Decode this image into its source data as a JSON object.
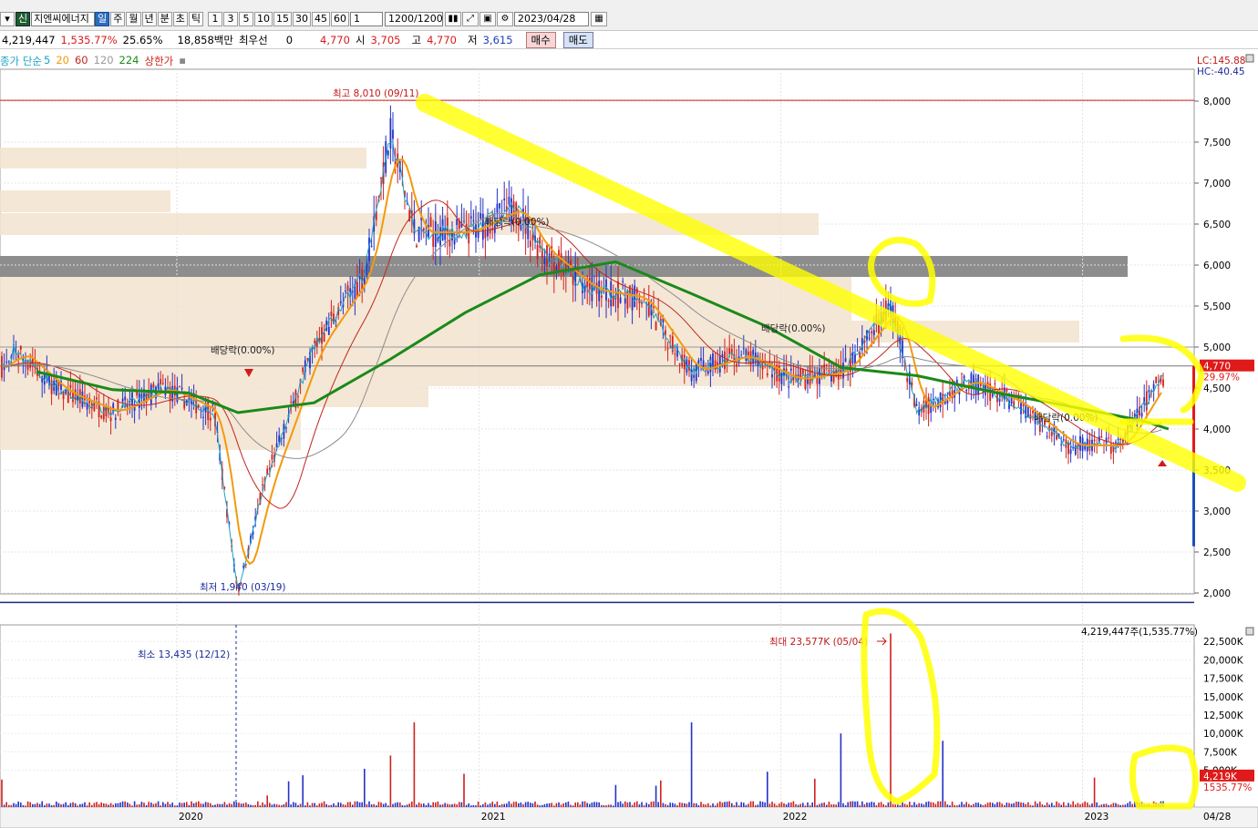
{
  "toolbar": {
    "code_badge": "신",
    "stock_name": "지엔씨에너지",
    "periods": [
      "일",
      "주",
      "월",
      "년",
      "분",
      "초",
      "틱"
    ],
    "active_period": "일",
    "minutes": [
      "1",
      "3",
      "5",
      "10",
      "15",
      "30",
      "45",
      "60"
    ],
    "count_select": "1",
    "range": "1200/1200",
    "date": "2023/04/28"
  },
  "info": {
    "volume": "4,219,447",
    "volume_pct": "1,535.77%",
    "turnover": "25.65%",
    "trade_value": "18,858백만",
    "priority_label": "최우선",
    "priority_value": "0",
    "current": "4,770",
    "open_label": "시",
    "open": "3,705",
    "high_label": "고",
    "high": "4,770",
    "low_label": "저",
    "low": "3,615",
    "buy_label": "매수",
    "sell_label": "매도"
  },
  "legend": {
    "prefix": "종가 단순",
    "ma5": "5",
    "ma20": "20",
    "ma60": "60",
    "ma120": "120",
    "ma224": "224",
    "limit_label": "상한가"
  },
  "colors": {
    "ma5": "#1aa3c7",
    "ma20": "#f29a0c",
    "ma60": "#c0261f",
    "ma120": "#8c8c8c",
    "ma224": "#1a8a1a",
    "up": "#d0201c",
    "down": "#2432c8",
    "highlight": "#ffff00",
    "volume_box": "#f3e3cf",
    "grey_band": "#8d8d8d"
  },
  "chart_data": [
    {
      "type": "candlestick",
      "x_ticks": [
        "2020",
        "2021",
        "2022",
        "2023"
      ],
      "y_ticks": [
        "8,000",
        "7,500",
        "7,000",
        "6,500",
        "6,000",
        "5,500",
        "5,000",
        "4,500",
        "4,000",
        "3,500",
        "3,000",
        "2,500",
        "2,000"
      ],
      "ylim": [
        1900,
        8300
      ],
      "lc_label": "LC:145.88",
      "hc_label": "HC:-40.45",
      "current_price": "4,770",
      "current_change": "29.97%",
      "annotations": {
        "high": "최고 8,010 (09/11)",
        "low": "최저 1,940 (03/19)",
        "dividend": "배당락(0.00%)"
      },
      "series": [
        {
          "name": "224",
          "x": [
            "2019-07",
            "2019-10",
            "2020-01",
            "2020-03",
            "2020-06",
            "2020-09",
            "2020-12",
            "2021-03",
            "2021-06",
            "2021-09",
            "2021-12",
            "2022-03",
            "2022-06",
            "2022-09",
            "2022-12",
            "2023-03",
            "2023-04"
          ],
          "values": [
            4700,
            4480,
            4440,
            4200,
            4320,
            4850,
            5420,
            5880,
            6040,
            5650,
            5250,
            4750,
            4650,
            4450,
            4280,
            4100,
            4000
          ]
        }
      ],
      "close": {
        "x": [
          "2019-06",
          "2019-08",
          "2019-10",
          "2019-12",
          "2020-02",
          "2020-03",
          "2020-04",
          "2020-06",
          "2020-08",
          "2020-09",
          "2020-10",
          "2020-12",
          "2021-02",
          "2021-03",
          "2021-05",
          "2021-07",
          "2021-09",
          "2021-11",
          "2022-01",
          "2022-03",
          "2022-05",
          "2022-06",
          "2022-08",
          "2022-10",
          "2022-12",
          "2023-02",
          "2023-04"
        ],
        "values": [
          5000,
          4450,
          4200,
          4500,
          4200,
          2000,
          3300,
          5000,
          5900,
          7600,
          6400,
          6400,
          6700,
          6200,
          5700,
          5600,
          4700,
          4900,
          4600,
          4700,
          5500,
          4200,
          4600,
          4300,
          3800,
          3800,
          4770
        ]
      }
    },
    {
      "type": "bar",
      "name": "volume",
      "y_ticks": [
        "22,500K",
        "20,000K",
        "17,500K",
        "15,000K",
        "12,500K",
        "10,000K",
        "7,500K",
        "5,000K"
      ],
      "ylim": [
        0,
        24000
      ],
      "last_label": "4,219K",
      "last_pct": "1535.77%",
      "summary": "4,219,447주(1,535.77%)",
      "max_annotation": "최대 23,577K (05/04)",
      "min_annotation": "최소 13,435 (12/12)",
      "date_label": "04/28",
      "x": [
        "2020-05",
        "2020-08",
        "2020-09",
        "2020-10",
        "2021-06",
        "2021-09",
        "2021-12",
        "2022-03",
        "2022-05",
        "2022-07",
        "2023-01",
        "2023-04"
      ],
      "values": [
        3500,
        5200,
        7000,
        11500,
        3000,
        11500,
        4800,
        10000,
        23577,
        9000,
        4000,
        4219
      ]
    }
  ]
}
